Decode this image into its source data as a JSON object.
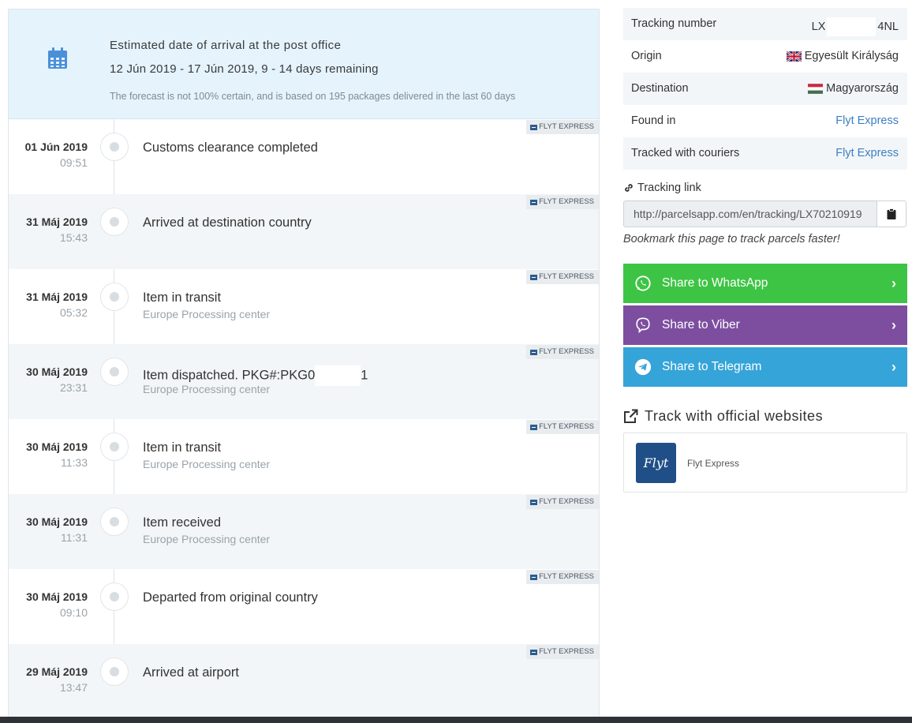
{
  "forecast": {
    "title": "Estimated date of arrival at the post office",
    "range": "12 Jún 2019 - 17 Jún 2019, 9 - 14 days remaining",
    "note": "The forecast is not 100% certain, and is based on 195 packages delivered in the last 60 days",
    "icon": "calendar-icon"
  },
  "events": [
    {
      "date": "01 Jún 2019",
      "time": "09:51",
      "status": "Customs clearance completed",
      "location": "",
      "courier": "FLYT EXPRESS"
    },
    {
      "date": "31 Máj 2019",
      "time": "15:43",
      "status": "Arrived at destination country",
      "location": "",
      "courier": "FLYT EXPRESS"
    },
    {
      "date": "31 Máj 2019",
      "time": "05:32",
      "status": "Item in transit",
      "location": "Europe Processing center",
      "courier": "FLYT EXPRESS"
    },
    {
      "date": "30 Máj 2019",
      "time": "23:31",
      "status_prefix": "Item dispatched. PKG#:PKG0",
      "status_suffix": "1",
      "location": "Europe Processing center",
      "courier": "FLYT EXPRESS"
    },
    {
      "date": "30 Máj 2019",
      "time": "11:33",
      "status": "Item in transit",
      "location": "Europe Processing center",
      "courier": "FLYT EXPRESS"
    },
    {
      "date": "30 Máj 2019",
      "time": "11:31",
      "status": "Item received",
      "location": "Europe Processing center",
      "courier": "FLYT EXPRESS"
    },
    {
      "date": "30 Máj 2019",
      "time": "09:10",
      "status": "Departed from original country",
      "location": "",
      "courier": "FLYT EXPRESS"
    },
    {
      "date": "29 Máj 2019",
      "time": "13:47",
      "status": "Arrived at airport",
      "location": "",
      "courier": "FLYT EXPRESS"
    }
  ],
  "info": {
    "tracking_number_label": "Tracking number",
    "tracking_number_prefix": "LX",
    "tracking_number_suffix": "4NL",
    "origin_label": "Origin",
    "origin_value": "Egyesült Királyság",
    "destination_label": "Destination",
    "destination_value": "Magyarország",
    "found_in_label": "Found in",
    "found_in_value": "Flyt Express",
    "couriers_label": "Tracked with couriers",
    "couriers_value": "Flyt Express"
  },
  "tracking_link": {
    "label": "Tracking link",
    "url": "http://parcelsapp.com/en/tracking/LX70210919",
    "bookmark_hint": "Bookmark this page to track parcels faster!"
  },
  "share": {
    "whatsapp": "Share to WhatsApp",
    "viber": "Share to Viber",
    "telegram": "Share to Telegram",
    "colors": {
      "whatsapp": "#3dc444",
      "viber": "#7d4e9f",
      "telegram": "#35a4d8"
    }
  },
  "official": {
    "title": "Track with official websites",
    "courier_name": "Flyt Express",
    "logo_text": "Flyt"
  }
}
